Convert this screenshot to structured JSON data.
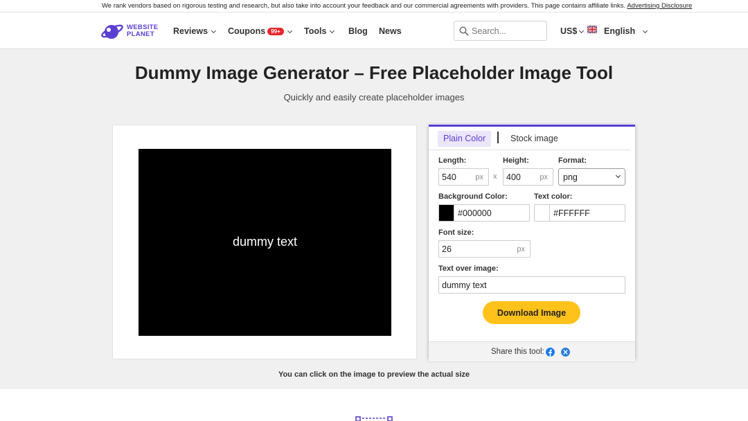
{
  "topbar": {
    "text": "We rank vendors based on rigorous testing and research, but also take into account your feedback and our commercial agreements with providers. This page contains affiliate links.",
    "link": "Advertising Disclosure"
  },
  "nav": {
    "logo_line1": "WEBSITE",
    "logo_line2": "PLANET",
    "reviews": "Reviews",
    "coupons": "Coupons",
    "coupons_badge": "99+",
    "tools": "Tools",
    "blog": "Blog",
    "news": "News",
    "search_placeholder": "Search...",
    "currency": "US$",
    "language": "English"
  },
  "page": {
    "title": "Dummy Image Generator – Free Placeholder Image Tool",
    "subtitle": "Quickly and easily create placeholder images",
    "hint": "You can click on the image to preview the actual size"
  },
  "preview": {
    "text": "dummy text",
    "background": "#000000",
    "text_color": "#FFFFFF"
  },
  "tool": {
    "tabs": [
      "Plain Color",
      "Stock image"
    ],
    "length_label": "Length:",
    "length": "540",
    "height_label": "Height:",
    "height": "400",
    "unit": "px",
    "times": "x",
    "format_label": "Format:",
    "format": "png",
    "bg_label": "Background Color:",
    "bg_value": "#000000",
    "text_color_label": "Text color:",
    "text_color_value": "#FFFFFF",
    "font_size_label": "Font size:",
    "font_size": "26",
    "text_over_label": "Text over image:",
    "text_over": "dummy text",
    "download": "Download Image",
    "share": "Share this tool:"
  },
  "colors": {
    "accent": "#5a3fd0",
    "button": "#ffc21a",
    "badge": "#e8262b",
    "facebook": "#1877f2",
    "x_share": "#2a7fd4"
  }
}
